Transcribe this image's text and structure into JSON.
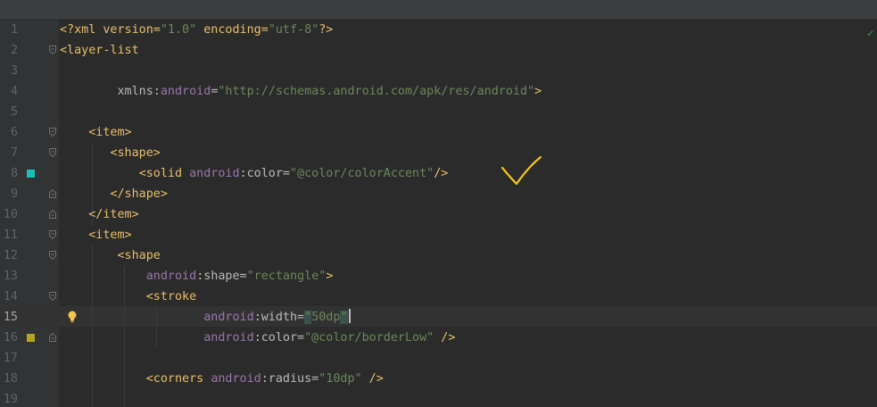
{
  "editor": {
    "inspection_status_icon": "check-icon",
    "lines": [
      {
        "number": "1",
        "tokens": [
          {
            "t": "<?xml version=",
            "c": "tag"
          },
          {
            "t": "\"1.0\"",
            "c": "val"
          },
          {
            "t": " encoding=",
            "c": "tag"
          },
          {
            "t": "\"utf-8\"",
            "c": "val"
          },
          {
            "t": "?>",
            "c": "tag"
          }
        ]
      },
      {
        "number": "2",
        "tokens": [
          {
            "t": "<layer-list",
            "c": "tag"
          }
        ]
      },
      {
        "number": "3",
        "tokens": []
      },
      {
        "number": "4",
        "tokens": [
          {
            "t": "        ",
            "c": "plain"
          },
          {
            "t": "xmlns:",
            "c": "attr"
          },
          {
            "t": "android",
            "c": "ns"
          },
          {
            "t": "=",
            "c": "attr"
          },
          {
            "t": "\"http://schemas.android.com/apk/res/android\"",
            "c": "val"
          },
          {
            "t": ">",
            "c": "tag"
          }
        ]
      },
      {
        "number": "5",
        "tokens": []
      },
      {
        "number": "6",
        "tokens": [
          {
            "t": "    ",
            "c": "plain"
          },
          {
            "t": "<item>",
            "c": "tag"
          }
        ]
      },
      {
        "number": "7",
        "tokens": [
          {
            "t": "       ",
            "c": "plain"
          },
          {
            "t": "<shape>",
            "c": "tag"
          }
        ]
      },
      {
        "number": "8",
        "tokens": [
          {
            "t": "           ",
            "c": "plain"
          },
          {
            "t": "<solid ",
            "c": "tag"
          },
          {
            "t": "android",
            "c": "ns"
          },
          {
            "t": ":color=",
            "c": "attr"
          },
          {
            "t": "\"@color/colorAccent\"",
            "c": "val"
          },
          {
            "t": "/>",
            "c": "tag"
          }
        ]
      },
      {
        "number": "9",
        "tokens": [
          {
            "t": "       ",
            "c": "plain"
          },
          {
            "t": "</shape>",
            "c": "tag"
          }
        ]
      },
      {
        "number": "10",
        "tokens": [
          {
            "t": "    ",
            "c": "plain"
          },
          {
            "t": "</item>",
            "c": "tag"
          }
        ]
      },
      {
        "number": "11",
        "tokens": [
          {
            "t": "    ",
            "c": "plain"
          },
          {
            "t": "<item>",
            "c": "tag"
          }
        ]
      },
      {
        "number": "12",
        "tokens": [
          {
            "t": "        ",
            "c": "plain"
          },
          {
            "t": "<shape",
            "c": "tag"
          }
        ]
      },
      {
        "number": "13",
        "tokens": [
          {
            "t": "            ",
            "c": "plain"
          },
          {
            "t": "android",
            "c": "ns"
          },
          {
            "t": ":shape=",
            "c": "attr"
          },
          {
            "t": "\"rectangle\"",
            "c": "val"
          },
          {
            "t": ">",
            "c": "tag"
          }
        ]
      },
      {
        "number": "14",
        "tokens": [
          {
            "t": "            ",
            "c": "plain"
          },
          {
            "t": "<stroke",
            "c": "tag"
          }
        ]
      },
      {
        "number": "15",
        "tokens": [
          {
            "t": "                    ",
            "c": "plain"
          },
          {
            "t": "android",
            "c": "ns"
          },
          {
            "t": ":width=",
            "c": "attr"
          },
          {
            "t": "\"",
            "c": "quote-hl"
          },
          {
            "t": "50dp",
            "c": "val"
          },
          {
            "t": "\"",
            "c": "quote-hl"
          }
        ]
      },
      {
        "number": "16",
        "tokens": [
          {
            "t": "                    ",
            "c": "plain"
          },
          {
            "t": "android",
            "c": "ns"
          },
          {
            "t": ":color=",
            "c": "attr"
          },
          {
            "t": "\"@color/borderLow\"",
            "c": "val"
          },
          {
            "t": " />",
            "c": "tag"
          }
        ]
      },
      {
        "number": "17",
        "tokens": []
      },
      {
        "number": "18",
        "tokens": [
          {
            "t": "            ",
            "c": "plain"
          },
          {
            "t": "<corners ",
            "c": "tag"
          },
          {
            "t": "android",
            "c": "ns"
          },
          {
            "t": ":radius=",
            "c": "attr"
          },
          {
            "t": "\"10dp\"",
            "c": "val"
          },
          {
            "t": " />",
            "c": "tag"
          }
        ]
      },
      {
        "number": "19",
        "tokens": []
      }
    ],
    "current_line": "15",
    "gutter_markers": [
      {
        "line": "8",
        "color": "#18c1b5",
        "name": "color-swatch-icon"
      },
      {
        "line": "16",
        "color": "#b5a51e",
        "name": "color-swatch-icon"
      }
    ],
    "intention_bulb": {
      "line": "15",
      "icon": "lightbulb-icon",
      "color": "#f2c94c"
    },
    "fold_markers": [
      {
        "line": "2",
        "kind": "open"
      },
      {
        "line": "6",
        "kind": "open"
      },
      {
        "line": "7",
        "kind": "open"
      },
      {
        "line": "9",
        "kind": "close"
      },
      {
        "line": "10",
        "kind": "close"
      },
      {
        "line": "11",
        "kind": "open"
      },
      {
        "line": "12",
        "kind": "open"
      },
      {
        "line": "14",
        "kind": "open"
      },
      {
        "line": "16",
        "kind": "close"
      }
    ],
    "annotation": {
      "icon": "handwritten-checkmark-icon",
      "color": "#f5c518"
    }
  }
}
